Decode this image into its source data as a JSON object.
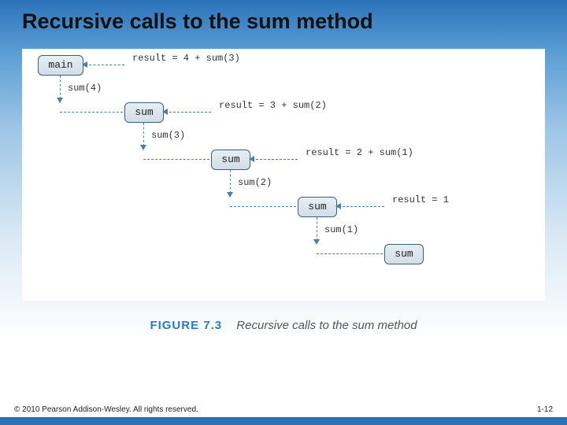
{
  "title": "Recursive calls to the sum method",
  "diagram": {
    "boxes": {
      "main": "main",
      "sum1": "sum",
      "sum2": "sum",
      "sum3": "sum",
      "sum4": "sum"
    },
    "calls": {
      "c1": "sum(4)",
      "c2": "sum(3)",
      "c3": "sum(2)",
      "c4": "sum(1)"
    },
    "results": {
      "r1": "result = 4 + sum(3)",
      "r2": "result = 3 + sum(2)",
      "r3": "result = 2 + sum(1)",
      "r4": "result = 1"
    }
  },
  "figure": {
    "label": "FIGURE 7.3",
    "text": "Recursive calls to the sum method"
  },
  "footer": {
    "copyright": "© 2010 Pearson Addison-Wesley. All rights reserved.",
    "pagenum": "1-12"
  }
}
